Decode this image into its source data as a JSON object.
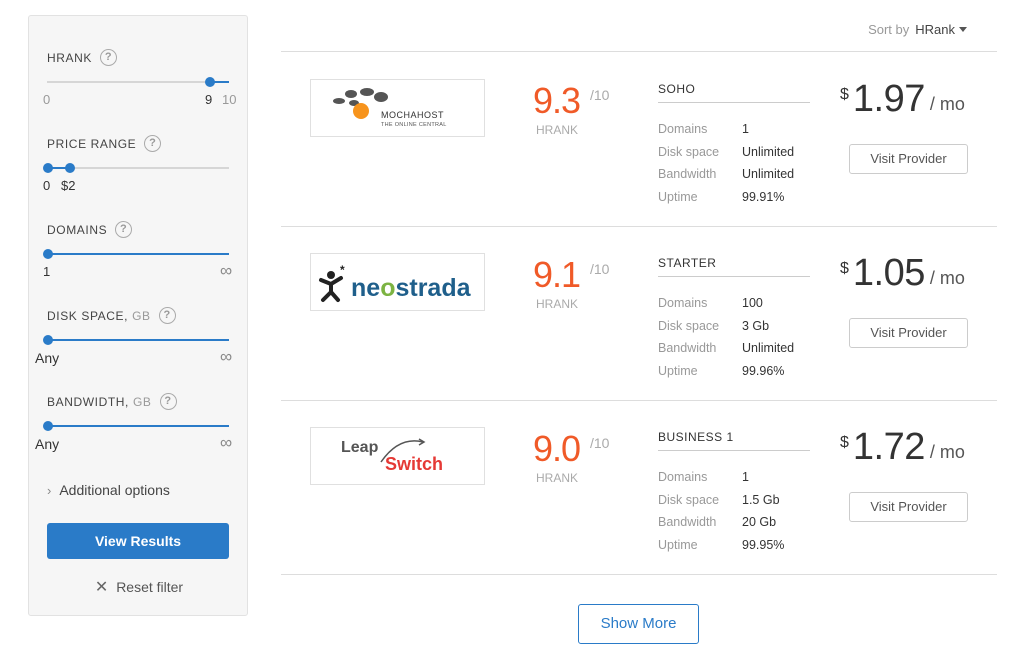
{
  "filters": {
    "hrank": {
      "label": "HRANK",
      "help": "?",
      "min": "0",
      "value": "9",
      "max": "10",
      "selected": 9
    },
    "price_range": {
      "label": "PRICE RANGE",
      "help": "?",
      "low": "0",
      "high": "$2"
    },
    "domains": {
      "label": "DOMAINS",
      "help": "?",
      "value": "1",
      "max": "∞"
    },
    "disk_space": {
      "label": "DISK SPACE,",
      "unit": "GB",
      "help": "?",
      "value": "Any",
      "max": "∞"
    },
    "bandwidth": {
      "label": "BANDWIDTH,",
      "unit": "GB",
      "help": "?",
      "value": "Any",
      "max": "∞"
    },
    "additional": {
      "chevron": "›",
      "label": "Additional options"
    },
    "view_results": "View Results",
    "reset": {
      "icon": "✕",
      "label": "Reset filter"
    }
  },
  "sort": {
    "label": "Sort by",
    "value": "HRank"
  },
  "providers": [
    {
      "logo": {
        "name": "MochaHost",
        "line1": "MOCHAHOST",
        "line2": "THE ONLINE CENTRAL"
      },
      "rating": "9.3",
      "rating_max": "/10",
      "rank_label": "HRANK",
      "plan": "SOHO",
      "specs": [
        {
          "label": "Domains",
          "value": "1"
        },
        {
          "label": "Disk space",
          "value": "Unlimited"
        },
        {
          "label": "Bandwidth",
          "value": "Unlimited"
        },
        {
          "label": "Uptime",
          "value": "99.91%"
        }
      ],
      "price": {
        "currency": "$",
        "amount": "1.97",
        "period": "/ mo"
      },
      "button": "Visit Provider"
    },
    {
      "logo": {
        "name": "neostrada",
        "text": "neostrada"
      },
      "rating": "9.1",
      "rating_max": "/10",
      "rank_label": "HRANK",
      "plan": "STARTER",
      "specs": [
        {
          "label": "Domains",
          "value": "100"
        },
        {
          "label": "Disk space",
          "value": "3 Gb"
        },
        {
          "label": "Bandwidth",
          "value": "Unlimited"
        },
        {
          "label": "Uptime",
          "value": "99.96%"
        }
      ],
      "price": {
        "currency": "$",
        "amount": "1.05",
        "period": "/ mo"
      },
      "button": "Visit Provider"
    },
    {
      "logo": {
        "name": "LeapSwitch",
        "word1": "Leap",
        "word2": "Switch"
      },
      "rating": "9.0",
      "rating_max": "/10",
      "rank_label": "HRANK",
      "plan": "BUSINESS 1",
      "specs": [
        {
          "label": "Domains",
          "value": "1"
        },
        {
          "label": "Disk space",
          "value": "1.5 Gb"
        },
        {
          "label": "Bandwidth",
          "value": "20 Gb"
        },
        {
          "label": "Uptime",
          "value": "99.95%"
        }
      ],
      "price": {
        "currency": "$",
        "amount": "1.72",
        "period": "/ mo"
      },
      "button": "Visit Provider"
    }
  ],
  "show_more": "Show More",
  "colors": {
    "accent": "#2a7bc8",
    "rating": "#f05a28"
  }
}
